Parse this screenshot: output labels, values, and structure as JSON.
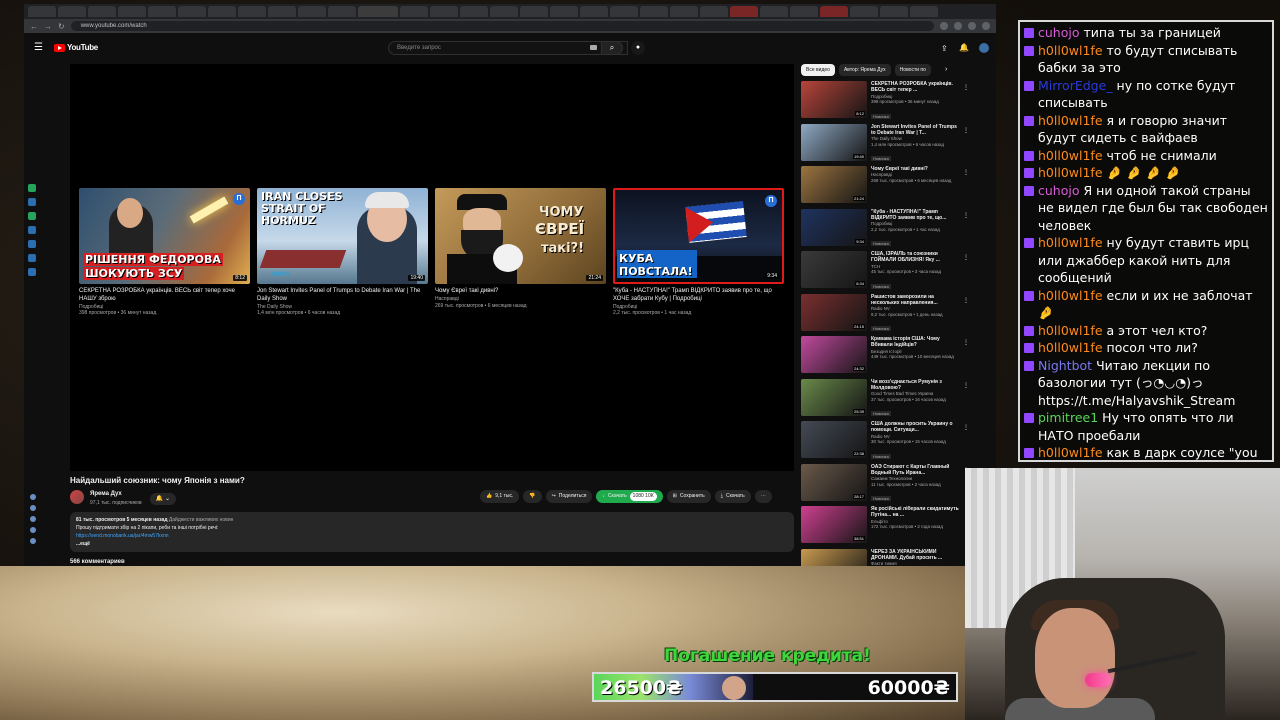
{
  "browser": {
    "url": "www.youtube.com/watch"
  },
  "youtube": {
    "logo_text": "YouTube",
    "search_placeholder": "Введите запрос"
  },
  "video": {
    "title": "Найдальший союзник: чому Японія з нами?",
    "channel": "Ярема Дух",
    "subscribers": "97,1 тыс. подписчиков",
    "likes": "9,1 тыс.",
    "share_label": "Поделиться",
    "download_green_label": "Скачать",
    "download_green_sub": "1080 10К",
    "save_label": "Сохранить",
    "download_label": "Скачать",
    "description": {
      "views": "81 тыс. просмотров",
      "date": "5 месяцев назад",
      "tag": "Дайджести важливих новин",
      "line": "Прошу підтримати збір на 2 пікапи, реби та інші потрібні речі:",
      "link": "https://send.monobank.ua/jar/4mw57kxnn",
      "more": "...ещё"
    },
    "comments_label": "566 комментариев"
  },
  "endscreen": [
    {
      "thumb_text_1": "РІШЕННЯ ФЕДОРОВА",
      "thumb_text_2": "ШОКУЮТЬ ЗСУ",
      "duration": "8:12",
      "title": "СЕКРЕТНА РОЗРОБКА українців. ВЕСЬ світ тепер хоче НАШУ зброю",
      "channel": "Подробиці",
      "meta": "398 просмотров • 36 минут назад"
    },
    {
      "thumb_text_1": "IRAN CLOSES",
      "thumb_text_2": "STRAIT OF",
      "thumb_text_3": "HORMUZ",
      "show_text": "SHOW",
      "duration": "19:40",
      "title": "Jon Stewart Invites Panel of Trumps to Debate Iran War | The Daily Show",
      "channel": "The Daily Show",
      "meta": "1,4 млн просмотров • 6 часов назад"
    },
    {
      "thumb_text_1": "ЧОМУ",
      "thumb_text_2": "ЄВРЕЇ",
      "thumb_text_3": "такі?!",
      "duration": "21:24",
      "title": "Чому Євреї такі дивні?",
      "channel": "Насправді",
      "meta": "269 тыс. просмотров • 6 месяцев назад"
    },
    {
      "thumb_text_1": "КУБА",
      "thumb_text_2": "ПОВСТАЛА!",
      "duration": "9:34",
      "title": "\"Куба - НАСТУПНА!\" Трамп ВІДКРИТО заявив про те, що ХОЧЕ забрати Кубу | Подробиці",
      "channel": "Подробиці",
      "meta": "2,2 тыс. просмотров • 1 час назад"
    }
  ],
  "sidebar": {
    "chips": [
      "Все видео",
      "Автор: Ярема Дух",
      "Новости по"
    ],
    "items": [
      {
        "title": "СЕКРЕТНА РОЗРОБКА українців. ВЕСЬ світ тепер ...",
        "channel": "Подробиці",
        "meta": "398 просмотров • 36 минут назад",
        "badge": "Новинка",
        "duration": "8:12",
        "color": "#b8453a"
      },
      {
        "title": "Jon Stewart Invites Panel of Trumps to Debate Iran War | T...",
        "channel": "The Daily Show",
        "meta": "1,4 млн просмотров • 6 часов назад",
        "badge": "Новинка",
        "duration": "19:40",
        "color": "#8fa9c4"
      },
      {
        "title": "Чому Євреї такі дивні?",
        "channel": "Насправді",
        "meta": "269 тыс. просмотров • 6 месяцев назад",
        "badge": "",
        "duration": "21:24",
        "color": "#9c7440"
      },
      {
        "title": "\"Куба - НАСТУПНА!\" Трамп ВІДКРИТО заявив про те, що...",
        "channel": "Подробиці",
        "meta": "2,2 тыс. просмотров • 1 час назад",
        "badge": "Новинка",
        "duration": "9:34",
        "color": "#1f3360"
      },
      {
        "title": "США, ІЗРАЇЛЬ та союзники ГОЙМАЛИ ОБЛИЗНЯ! Яку ...",
        "channel": "ТСН",
        "meta": "45 тыс. просмотров • 3 часа назад",
        "badge": "Новинка",
        "duration": "6:34",
        "color": "#3a3a3a"
      },
      {
        "title": "Рашистов заморозили на нескольких направления...",
        "channel": "Radio NV",
        "meta": "9,2 тыс. просмотров • 1 день назад",
        "badge": "Новинка",
        "duration": "24:15",
        "color": "#7a2f2f"
      },
      {
        "title": "Кривава історія США: Чому Вбивали Індійців?",
        "channel": "Безодня Історії",
        "meta": "449 тыс. просмотров • 10 месяцев назад",
        "badge": "",
        "duration": "24:32",
        "color": "#c24a9e"
      },
      {
        "title": "Чи возз'єднається Румунія з Молдовою?",
        "channel": "Good Times Bad Times Україна",
        "meta": "37 тыс. просмотров • 16 часов назад",
        "badge": "Новинка",
        "duration": "25:39",
        "color": "#6a8a4a"
      },
      {
        "title": "США должны просить Украину о помощи. Ситуаци...",
        "channel": "Radio NV",
        "meta": "30 тыс. просмотров • 15 часов назад",
        "badge": "Новинка",
        "duration": "22:38",
        "color": "#444a55"
      },
      {
        "title": "ОАЭ Стирают с Карты Главный Водный Путь Ирана...",
        "channel": "Сажаем Технологии",
        "meta": "11 тыс. просмотров • 2 часа назад",
        "badge": "Новинка",
        "duration": "28:17",
        "color": "#6a5a4a"
      },
      {
        "title": "Як російські ліберали скидатимуть Путіна... на ...",
        "channel": "Ельфіто",
        "meta": "172 тыс. просмотров • 2 года назад",
        "badge": "",
        "duration": "38:51",
        "color": "#d04090"
      },
      {
        "title": "ЧЕРЕЗ ЗА УКРАЇНСЬКИМИ ДРОНАМИ. Дубай просить ...",
        "channel": "Факти тижня",
        "meta": "",
        "badge": "",
        "duration": "",
        "color": "#c89a50"
      }
    ]
  },
  "chat": [
    {
      "user": "cuhojo",
      "color": "#d85ad8",
      "text": "типа ты за границей"
    },
    {
      "user": "h0ll0wl1fe",
      "color": "#ff8a1a",
      "text": "то будут списывать бабки за это"
    },
    {
      "user": "MirrorEdge_",
      "color": "#2a3ad8",
      "text": "ну по сотке будут списывать"
    },
    {
      "user": "h0ll0wl1fe",
      "color": "#ff8a1a",
      "text": "я и говорю значит будут сидеть с вайфаев"
    },
    {
      "user": "h0ll0wl1fe",
      "color": "#ff8a1a",
      "text": "чтоб не снимали"
    },
    {
      "user": "h0ll0wl1fe",
      "color": "#ff8a1a",
      "text": "🤌 🤌 🤌 🤌"
    },
    {
      "user": "cuhojo",
      "color": "#d85ad8",
      "text": "Я ни одной такой страны не видел где был бы так свободен человек"
    },
    {
      "user": "h0ll0wl1fe",
      "color": "#ff8a1a",
      "text": "ну будут ставить ирц или джаббер какой нить для сообщений"
    },
    {
      "user": "h0ll0wl1fe",
      "color": "#ff8a1a",
      "text": "если и их не заблочат 🤌"
    },
    {
      "user": "h0ll0wl1fe",
      "color": "#ff8a1a",
      "text": "а этот чел кто?"
    },
    {
      "user": "h0ll0wl1fe",
      "color": "#ff8a1a",
      "text": "посол что ли?"
    },
    {
      "user": "Nightbot",
      "color": "#7a78f0",
      "text": "Читаю лекции по базологии тут (っ◔◡◔)っ https://t.me/Halyavshik_Stream"
    },
    {
      "user": "pimitree1",
      "color": "#5ad65a",
      "text": "Ну что опять что ли НАТО проебали"
    },
    {
      "user": "h0ll0wl1fe",
      "color": "#ff8a1a",
      "text": "как в дарк соулсе \"you died\""
    }
  ],
  "donation": {
    "title": "Погашение кредита!",
    "current": "26500₴",
    "goal": "60000₴",
    "progress": 0.44
  }
}
